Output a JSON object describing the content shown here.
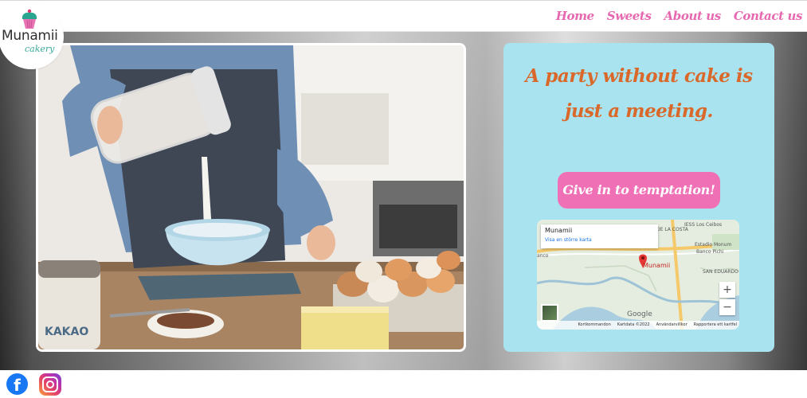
{
  "logo": {
    "brand": "Munamii",
    "sub": "cakery",
    "icon": "cupcake-icon"
  },
  "nav": {
    "items": [
      "Home",
      "Sweets",
      "About us",
      "Contact us"
    ]
  },
  "hero": {
    "quote": "A party without cake is just a meeting.",
    "cta_label": "Give in to temptation!",
    "photo": {
      "packet_text": "KAKAO"
    }
  },
  "map": {
    "info_title": "Munamii",
    "info_link": "Visa en större karta",
    "pin_label": "Munamii",
    "place_labels": [
      "IESS Los Ceibos",
      "Estadio Monum",
      "Banco Pichi",
      "SAN EDUARDO",
      "DE LA COSTA",
      "anco"
    ],
    "zoom_in": "+",
    "zoom_out": "−",
    "brand": "Google",
    "footer": [
      "Kortkommandon",
      "Kartdata ©2022",
      "Användarvillkor",
      "Rapportera ett kartfel"
    ]
  },
  "social": {
    "facebook_glyph": "f",
    "icons": [
      "facebook-icon",
      "instagram-icon"
    ]
  },
  "colors": {
    "accent_pink": "#e668b0",
    "quote_orange": "#d9682a",
    "card_blue": "#a9e3ef",
    "cta_pink": "#ef70b5"
  }
}
